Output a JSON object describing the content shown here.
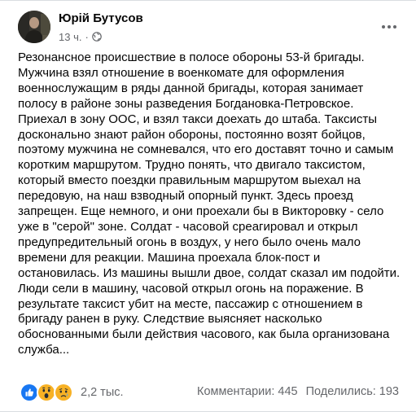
{
  "post": {
    "author": "Юрій Бутусов",
    "time": "13 ч.",
    "separator": "·",
    "privacy_icon": "globe-icon",
    "more_icon": "more-horizontal-icon",
    "text_lines": [
      "Резонансное происшествие в полосе обороны 53-й бригады.",
      "Мужчина взял отношение в военкомате для оформления",
      "военнослужащим в ряды данной бригады, которая занимает",
      "полосу в районе зоны разведения Богдановка-Петровское.",
      "Приехал в зону ООС, и взял такси доехать до штаба. Таксисты",
      "досконально знают район обороны, постоянно возят бойцов,",
      "поэтому мужчина не сомневался, что его доставят точно и самым",
      "коротким маршрутом. Трудно понять, что двигало таксистом,",
      "который вместо поездки правильным маршрутом выехал на",
      "передовую, на наш взводный опорный пункт. Здесь проезд",
      "запрещен. Еще немного, и они проехали бы в Викторовку - село",
      "уже в \"серой\" зоне. Солдат - часовой среагировал и открыл",
      "предупредительный огонь в воздух, у него было очень мало",
      "времени для реакции. Машина проехала блок-пост и",
      "остановилась. Из машины вышли двое, солдат сказал им подойти.",
      "Люди сели в машину, часовой открыл огонь на поражение. В",
      "результате таксист убит на месте, пассажир с отношением в",
      "бригаду ранен в руку. Следствие выясняет насколько",
      "обоснованными были действия часового, как была организована",
      "служба..."
    ]
  },
  "footer": {
    "reaction_icons": [
      "like-reaction-icon",
      "wow-reaction-icon",
      "sad-reaction-icon"
    ],
    "reactions_count": "2,2 тыс.",
    "comments": "Комментарии: 445",
    "shares": "Поделились: 193"
  },
  "colors": {
    "text": "#050505",
    "secondary": "#65676b",
    "like_blue": "#1877f2",
    "emoji_yellow": "#f7b125"
  }
}
